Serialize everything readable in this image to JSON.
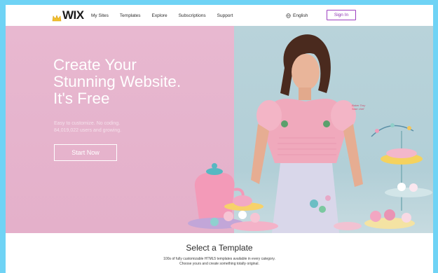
{
  "brand": {
    "logo_text": "WIX",
    "accent": "#8a2fb0",
    "frame_color": "#6fd3f5"
  },
  "nav": {
    "links": [
      "My Sites",
      "Templates",
      "Explore",
      "Subscriptions",
      "Support"
    ],
    "language": "English",
    "language_icon": "globe-icon",
    "sign_in": "Sign In"
  },
  "hero": {
    "headline": "Create Your\nStunning Website.\nIt's Free",
    "subtext": "Easy to customize. No coding.\n84,019,022 users and growing.",
    "cta": "Start Now",
    "annotation": "Baker Tory\nStarr chef"
  },
  "templates": {
    "title": "Select a Template",
    "description": "100s of fully customizable HTML5 templates available in every category.\nChoose yours and create something totally original."
  }
}
